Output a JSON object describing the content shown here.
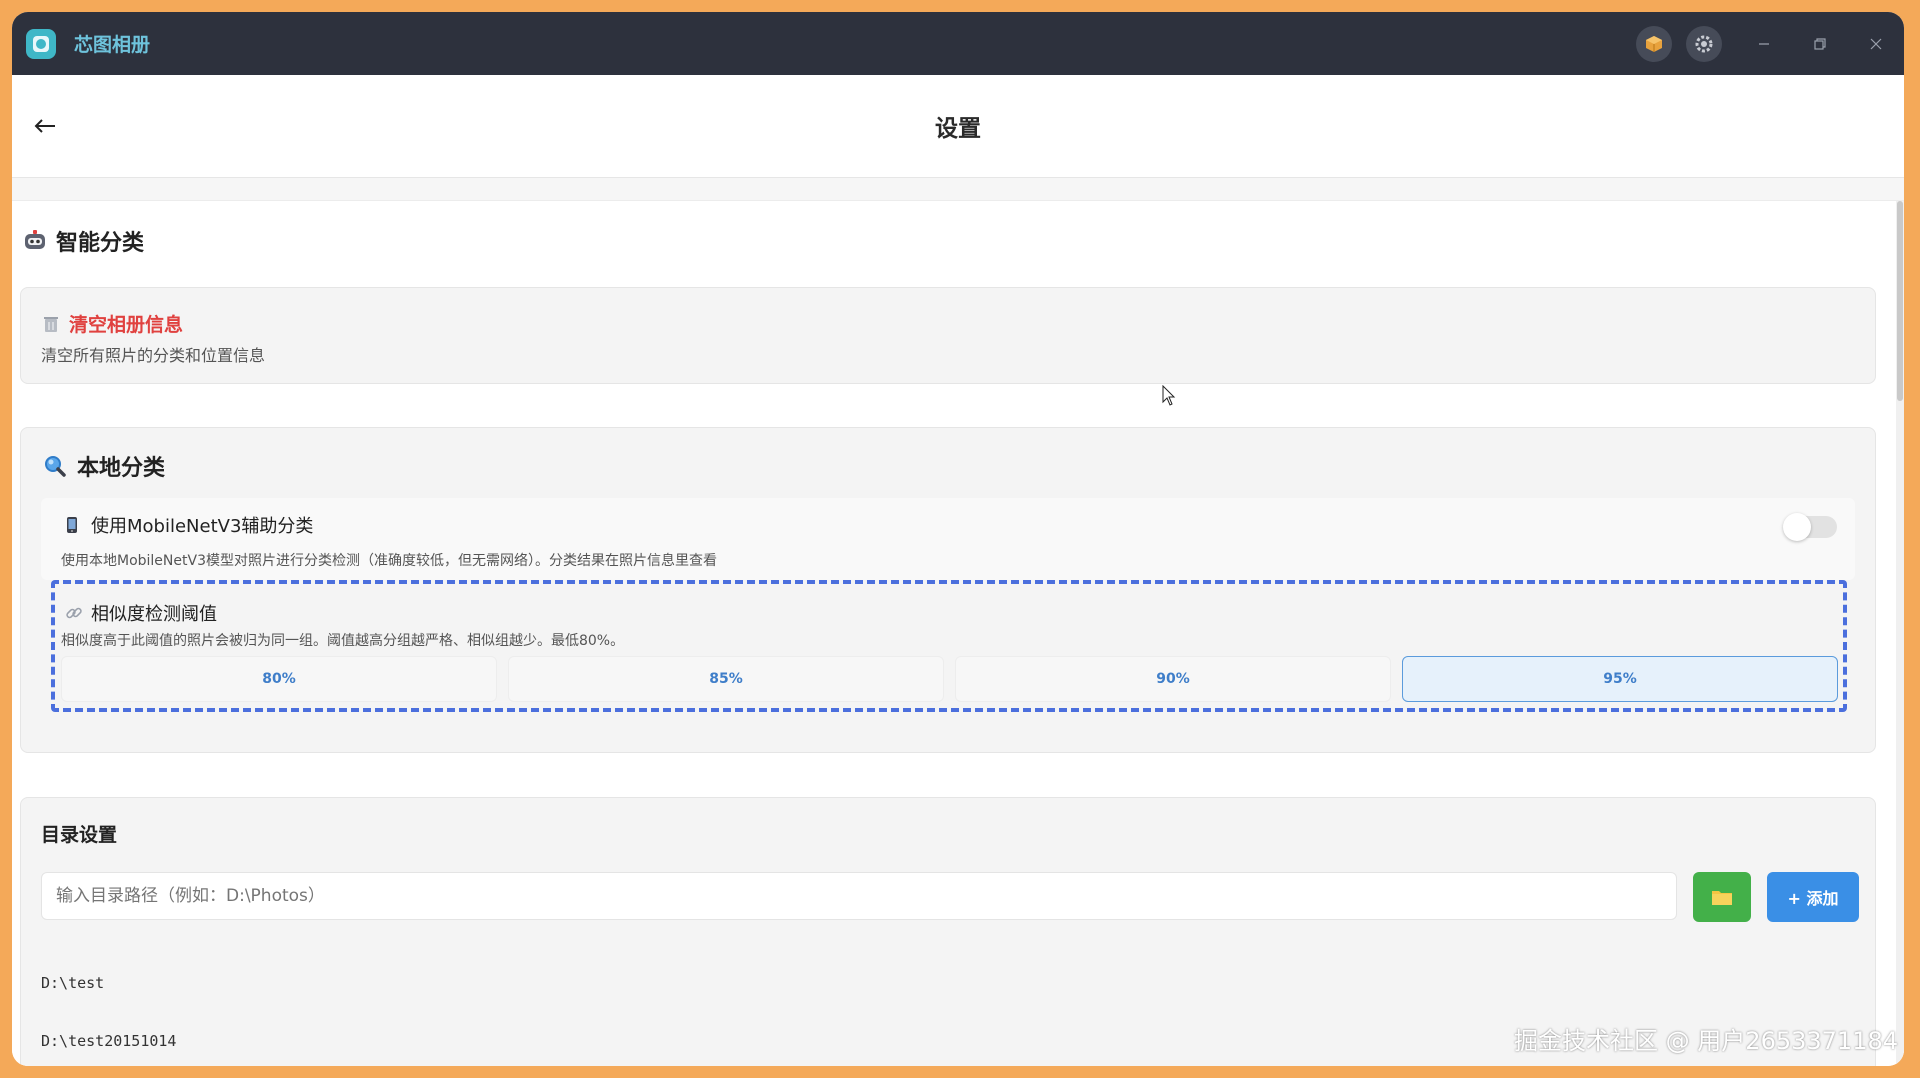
{
  "app": {
    "title": "芯图相册"
  },
  "page": {
    "title": "设置"
  },
  "smart": {
    "title": "智能分类"
  },
  "clear": {
    "title": "清空相册信息",
    "desc": "清空所有照片的分类和位置信息"
  },
  "local": {
    "title": "本地分类",
    "mobilenet": {
      "label": "使用MobileNetV3辅助分类",
      "desc": "使用本地MobileNetV3模型对照片进行分类检测（准确度较低，但无需网络）。分类结果在照片信息里查看",
      "enabled": false
    },
    "threshold": {
      "label": "相似度检测阈值",
      "desc": "相似度高于此阈值的照片会被归为同一组。阈值越高分组越严格、相似组越少。最低80%。",
      "options": [
        "80%",
        "85%",
        "90%",
        "95%"
      ],
      "selected": "95%"
    }
  },
  "dir": {
    "title": "目录设置",
    "placeholder": "输入目录路径（例如：D:\\Photos）",
    "add_label": "+ 添加",
    "items": [
      "D:\\test",
      "D:\\test20151014"
    ]
  },
  "watermark": "掘金技术社区 @ 用户2653371184",
  "colors": {
    "accent": "#3a8fe6",
    "danger": "#e0413f",
    "folder": "#43b049",
    "titlebar": "#2d313d",
    "frame": "#f4a959"
  }
}
